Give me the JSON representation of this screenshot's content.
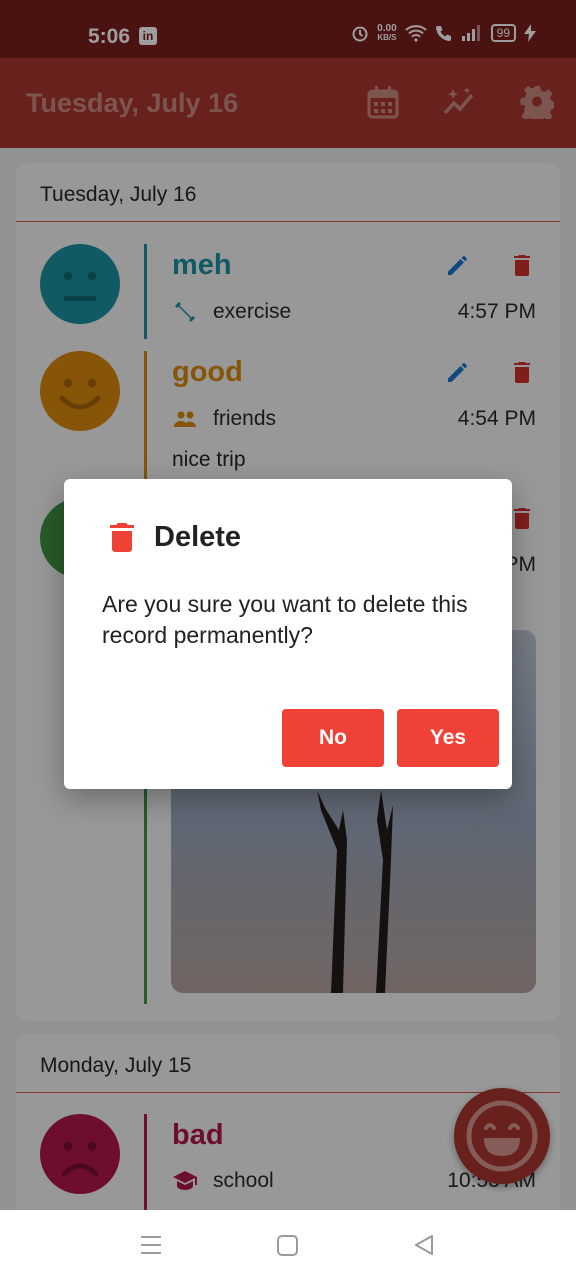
{
  "status_bar": {
    "time": "5:06",
    "linkedin_badge": "in",
    "network_speed_value": "0.00",
    "network_speed_unit": "KB/S",
    "battery": "99"
  },
  "app_bar": {
    "title": "Tuesday, July 16",
    "icons": [
      "calendar-icon",
      "insights-icon",
      "settings-icon"
    ]
  },
  "cards": [
    {
      "date": "Tuesday, July 16",
      "entries": [
        {
          "mood": "meh",
          "mood_color": "#1b93a1",
          "activity": "exercise",
          "activity_icon": "dumbbell-icon",
          "time": "4:57 PM"
        },
        {
          "mood": "good",
          "mood_color": "#d98a0c",
          "activity": "friends",
          "activity_icon": "people-icon",
          "time": "4:54 PM",
          "note": "nice trip"
        },
        {
          "mood_color": "#3f9443",
          "time": "PM"
        }
      ]
    },
    {
      "date": "Monday, July 15",
      "entries": [
        {
          "mood": "bad",
          "mood_color": "#b0184e",
          "activity": "school",
          "activity_icon": "graduation-cap-icon",
          "time": "10:53 AM"
        }
      ]
    }
  ],
  "dialog": {
    "title": "Delete",
    "message": "Are you sure you want to delete this record permanently?",
    "no_label": "No",
    "yes_label": "Yes"
  },
  "colors": {
    "status_bar": "#7a1d1d",
    "app_bar": "#a8362e",
    "dialog_button": "#ef4136",
    "delete_icon": "#d0312d",
    "edit_icon": "#1976d2"
  }
}
